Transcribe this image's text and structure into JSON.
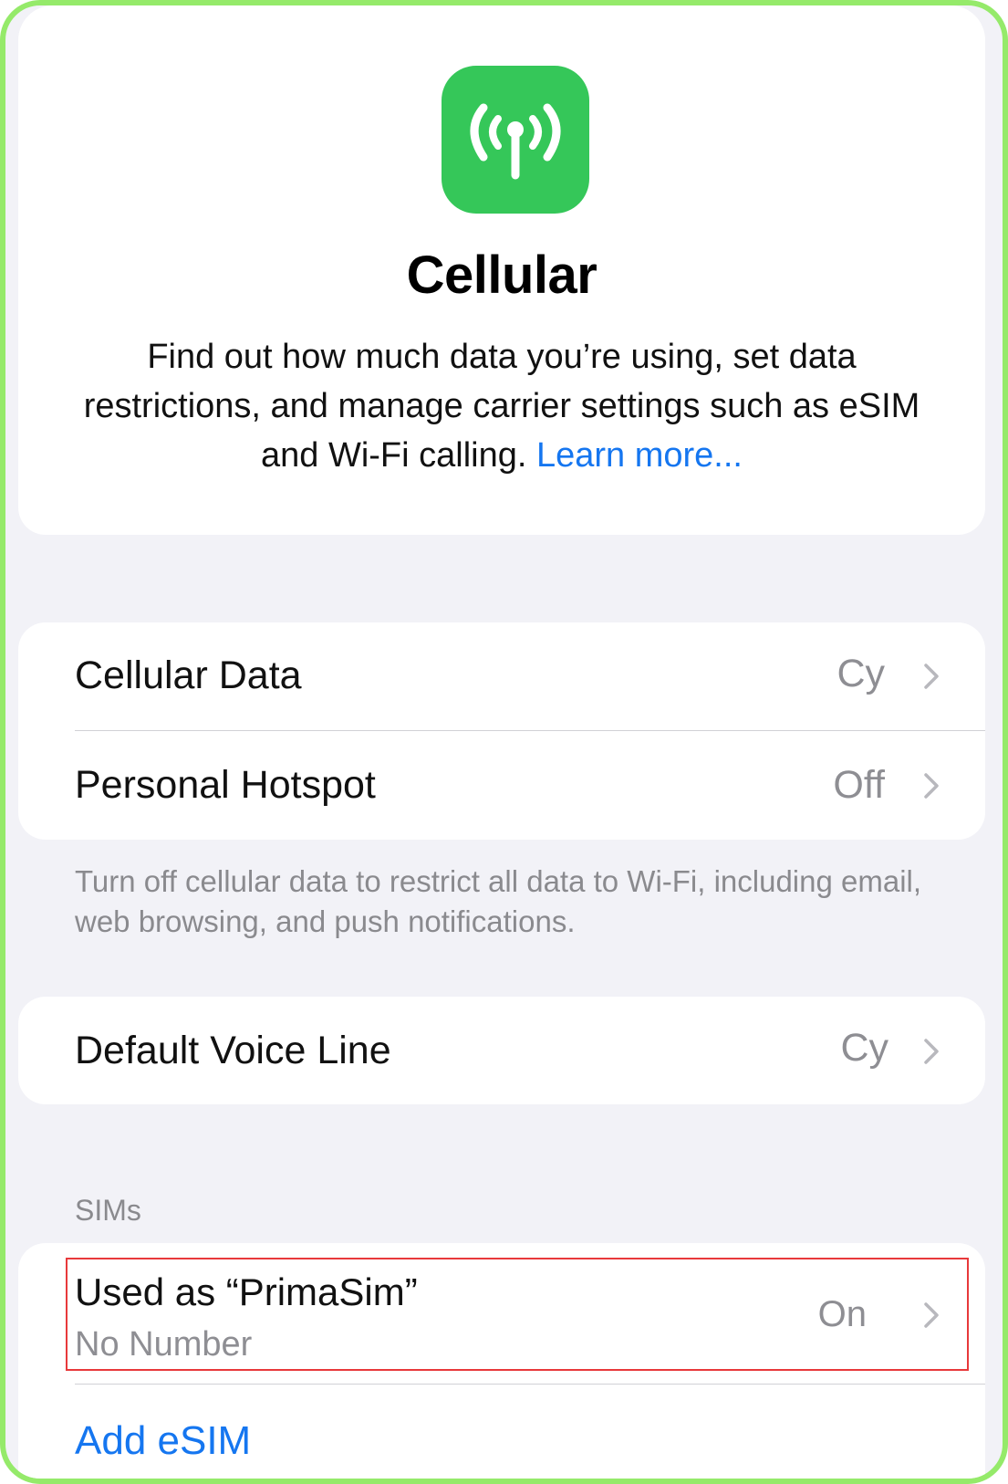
{
  "header": {
    "icon": "antenna-signal-icon",
    "icon_color": "#35c759",
    "title": "Cellular",
    "description": "Find out how much data you’re using, set data restrictions, and manage carrier settings such as eSIM and Wi-Fi calling.",
    "learn_more": "Learn more..."
  },
  "group1": {
    "cellular_data": {
      "label": "Cellular Data",
      "value": "Cy"
    },
    "personal_hotspot": {
      "label": "Personal Hotspot",
      "value": "Off"
    },
    "footnote": "Turn off cellular data to restrict all data to Wi-Fi, including email, web browsing, and push notifications."
  },
  "group2": {
    "default_voice_line": {
      "label": "Default Voice Line",
      "value": "Cy"
    }
  },
  "sims": {
    "header": "SIMs",
    "sim1": {
      "label": "Used as “PrimaSim”",
      "subtitle": "No Number",
      "value": "On"
    },
    "add_esim": "Add eSIM"
  },
  "colors": {
    "accent": "#1576f0",
    "highlight": "#e8393b",
    "frame": "#95ea6a"
  }
}
